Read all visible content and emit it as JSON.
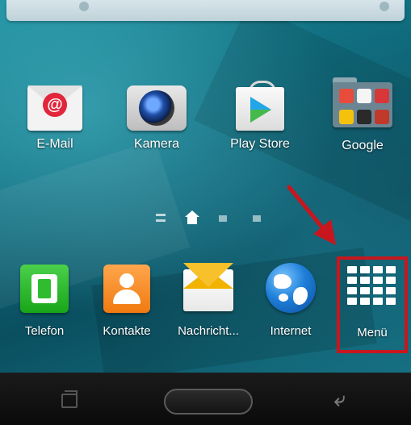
{
  "home_screen": {
    "apps": [
      {
        "label": "E-Mail",
        "icon": "email-icon"
      },
      {
        "label": "Kamera",
        "icon": "camera-icon"
      },
      {
        "label": "Play Store",
        "icon": "play-store-icon"
      },
      {
        "label": "Google",
        "icon": "google-folder-icon"
      }
    ]
  },
  "dock": {
    "apps": [
      {
        "label": "Telefon",
        "icon": "phone-icon"
      },
      {
        "label": "Kontakte",
        "icon": "contacts-icon"
      },
      {
        "label": "Nachricht...",
        "icon": "messages-icon"
      },
      {
        "label": "Internet",
        "icon": "internet-icon"
      },
      {
        "label": "Menü",
        "icon": "apps-grid-icon"
      }
    ]
  },
  "colors": {
    "highlight": "#c8161e",
    "arrow": "#c8161e",
    "wallpaper": "#0f6b7c"
  }
}
